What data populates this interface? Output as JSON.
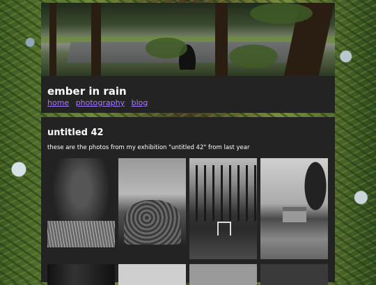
{
  "site": {
    "title": "ember in rain",
    "nav": [
      {
        "label": "home"
      },
      {
        "label": "photography"
      },
      {
        "label": "blog"
      }
    ],
    "link_color": "#a67bff",
    "panel_color": "#232323"
  },
  "page": {
    "title": "untitled 42",
    "description": "these are the photos from my exhibition \"untitled 42\" from last year"
  }
}
